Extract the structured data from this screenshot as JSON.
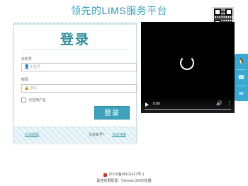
{
  "header": {
    "title_prefix": "领先的",
    "title_brand": "LIMS",
    "title_suffix": "服务平台"
  },
  "login": {
    "title": "登录",
    "username_label": "手机号",
    "username_placeholder": "手机号",
    "password_label": "密码",
    "password_placeholder": "密码",
    "remember_label": "记住用户名",
    "submit_label": "登录",
    "forgot_label": "忘记密码",
    "no_account_label": "没有帐号？",
    "register_label": "点击注册"
  },
  "video": {
    "time": "0:00"
  },
  "footer": {
    "icp": "沪ICP备08101427号-1",
    "browser_note": "最佳效果配置：Chrome,360浏览器"
  },
  "colors": {
    "accent": "#3ea3ba",
    "title": "#2f8e9b",
    "side_tab": "#39a9d2"
  },
  "icons": {
    "user_field": "user-icon",
    "password_field": "lock-icon",
    "side_tab_1": "qq-icon",
    "side_tab_2": "phone-icon",
    "side_tab_3": "chat-icon"
  }
}
